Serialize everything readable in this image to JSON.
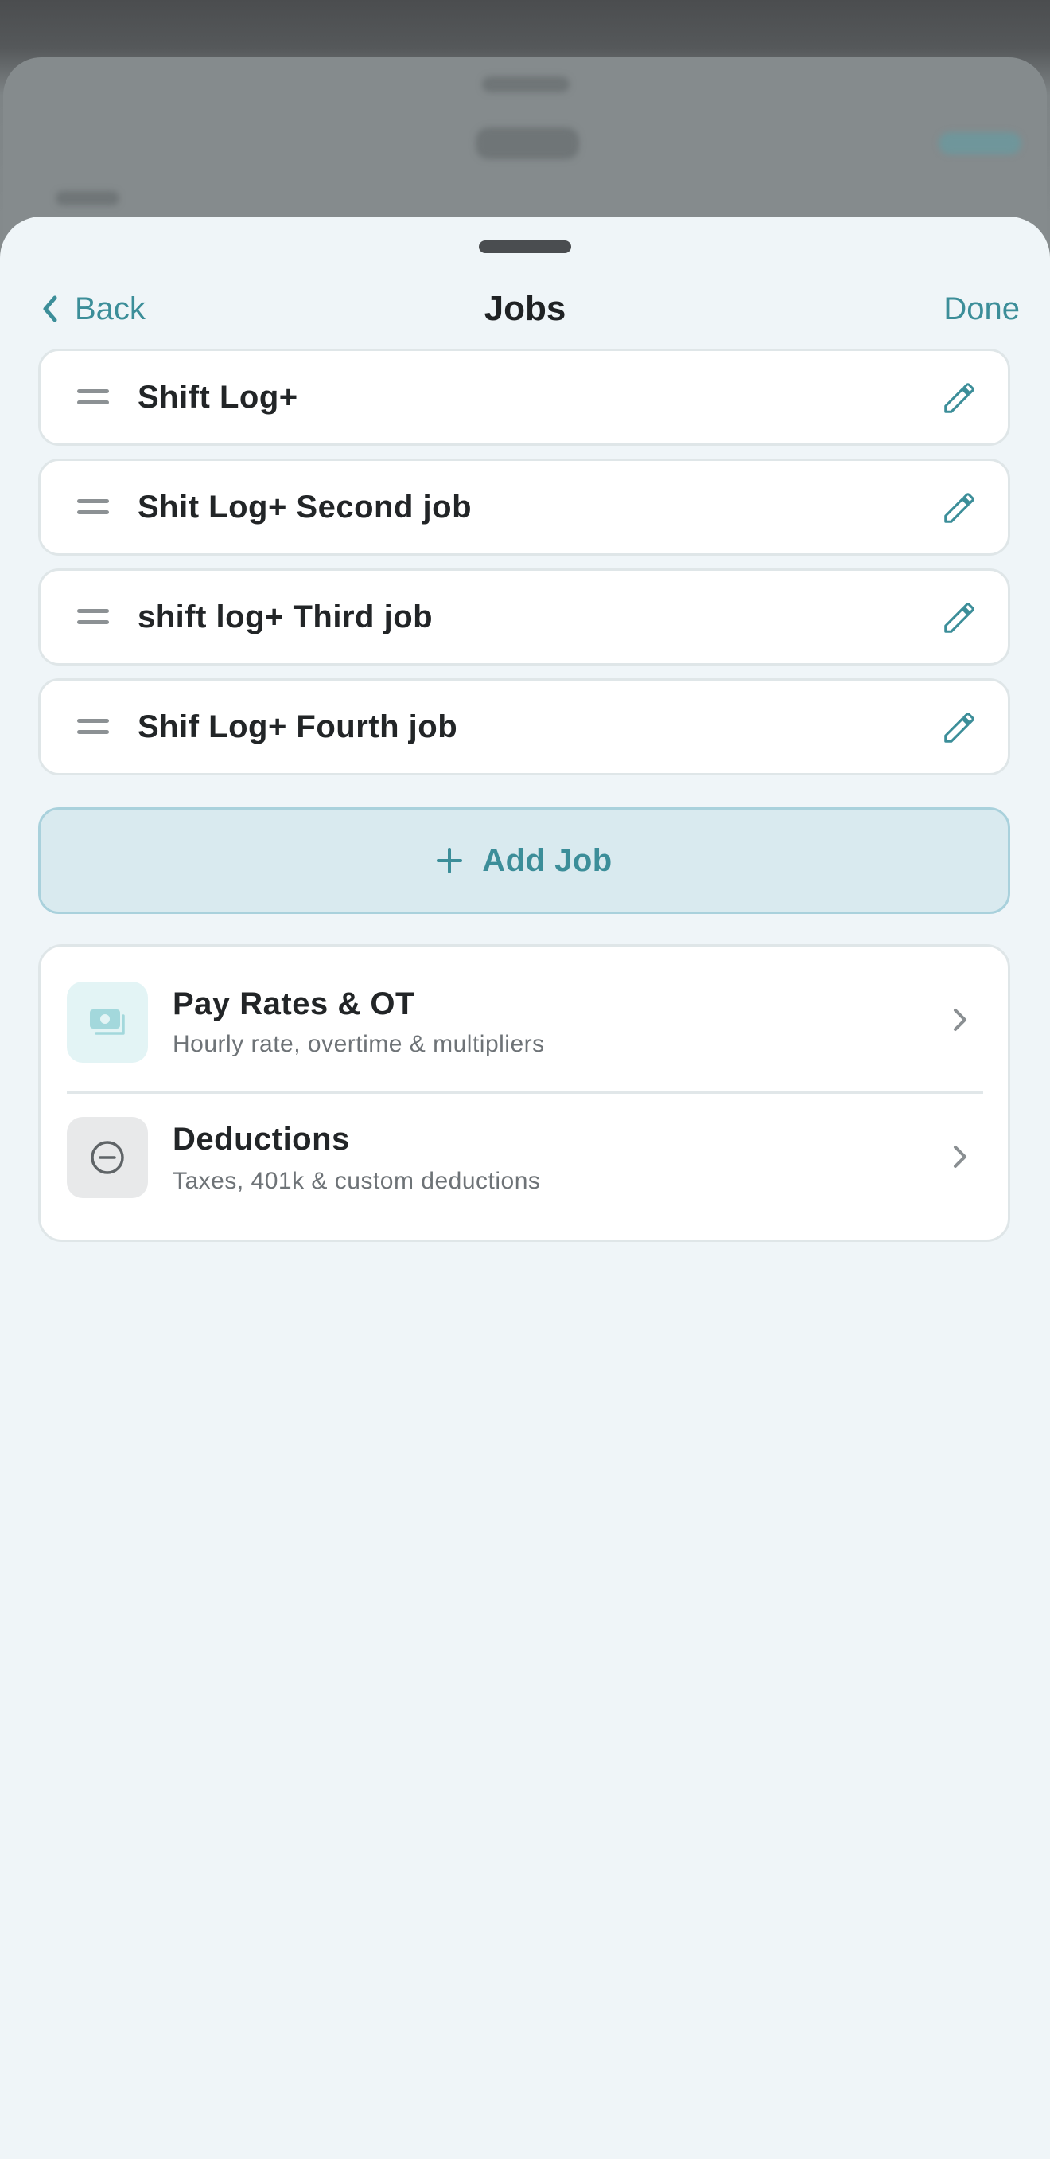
{
  "nav": {
    "back_label": "Back",
    "title": "Jobs",
    "done_label": "Done"
  },
  "jobs": [
    {
      "name": "Shift Log+"
    },
    {
      "name": "Shit Log+ Second job"
    },
    {
      "name": "shift log+ Third job"
    },
    {
      "name": "Shif Log+ Fourth job"
    }
  ],
  "add_job": {
    "label": "Add Job"
  },
  "settings": {
    "pay_rates": {
      "title": "Pay Rates & OT",
      "subtitle": "Hourly rate, overtime & multipliers",
      "icon": "money-icon"
    },
    "deductions": {
      "title": "Deductions",
      "subtitle": "Taxes, 401k & custom deductions",
      "icon": "minus-circle-icon"
    }
  },
  "colors": {
    "accent": "#3c8e99",
    "sheet_background": "#eff5f8",
    "add_button_background": "#d9eaef",
    "card_background": "#ffffff",
    "title_text": "#1f2224"
  }
}
